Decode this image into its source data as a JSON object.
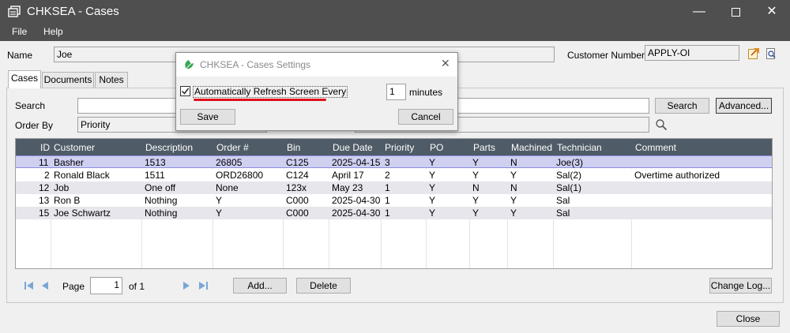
{
  "window": {
    "title": "CHKSEA - Cases"
  },
  "menu": [
    "File",
    "Help"
  ],
  "header": {
    "name_label": "Name",
    "name_value": "Joe",
    "customer_number_label": "Customer Number",
    "customer_number_value": "APPLY-OI"
  },
  "tabs": [
    "Cases",
    "Documents",
    "Notes"
  ],
  "search": {
    "search_label": "Search",
    "order_by_label": "Order By",
    "order_by_value": "Priority",
    "search_button": "Search",
    "advanced_button": "Advanced..."
  },
  "table": {
    "columns": [
      "ID",
      "Customer",
      "Description",
      "Order #",
      "Bin",
      "Due Date",
      "Priority",
      "PO",
      "Parts",
      "Machined",
      "Technician",
      "Comment"
    ],
    "rows": [
      [
        "11",
        "Basher",
        "1513",
        "26805",
        "C125",
        "2025-04-15",
        "3",
        "Y",
        "Y",
        "N",
        "Joe(3)",
        ""
      ],
      [
        "2",
        "Ronald Black",
        "1511",
        "ORD26800",
        "C124",
        "April 17",
        "2",
        "Y",
        "Y",
        "Y",
        "Sal(2)",
        "Overtime authorized"
      ],
      [
        "12",
        "Job",
        "One off",
        "None",
        "123x",
        "May 23",
        "1",
        "Y",
        "N",
        "N",
        "Sal(1)",
        ""
      ],
      [
        "13",
        "Ron B",
        "Nothing",
        "Y",
        "C000",
        "2025-04-30",
        "1",
        "Y",
        "Y",
        "Y",
        "Sal",
        ""
      ],
      [
        "15",
        "Joe Schwartz",
        "Nothing",
        "Y",
        "C000",
        "2025-04-30",
        "1",
        "Y",
        "Y",
        "Y",
        "Sal",
        ""
      ]
    ]
  },
  "pager": {
    "page_label": "Page",
    "page_value": "1",
    "of_label": "of 1",
    "add_button": "Add...",
    "delete_button": "Delete",
    "change_log_button": "Change Log..."
  },
  "footer": {
    "close_button": "Close"
  },
  "dialog": {
    "title": "CHKSEA - Cases Settings",
    "checkbox_label": "Automatically Refresh Screen Every",
    "checkbox_checked": true,
    "minutes_value": "1",
    "minutes_label": "minutes",
    "save_button": "Save",
    "cancel_button": "Cancel"
  },
  "colors": {
    "titlebar": "#4f4f4f",
    "grid_header": "#4f5b66",
    "selected_row": "#cfd0f0",
    "stripe_row": "#e6e6ec",
    "annotation_underline": "#e0101a"
  }
}
